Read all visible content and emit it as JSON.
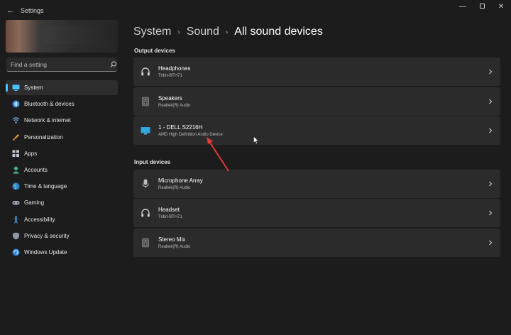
{
  "window": {
    "title": "Settings",
    "back_glyph": "←",
    "minimize_glyph": "—",
    "close_glyph": "✕"
  },
  "sidebar": {
    "search_placeholder": "Find a setting",
    "items": [
      {
        "label": "System",
        "icon": "monitor-icon",
        "selected": true
      },
      {
        "label": "Bluetooth & devices",
        "icon": "bluetooth-icon"
      },
      {
        "label": "Network & internet",
        "icon": "wifi-icon"
      },
      {
        "label": "Personalization",
        "icon": "brush-icon"
      },
      {
        "label": "Apps",
        "icon": "apps-icon"
      },
      {
        "label": "Accounts",
        "icon": "account-icon"
      },
      {
        "label": "Time & language",
        "icon": "globe-icon"
      },
      {
        "label": "Gaming",
        "icon": "gamepad-icon"
      },
      {
        "label": "Accessibility",
        "icon": "accessibility-icon"
      },
      {
        "label": "Privacy & security",
        "icon": "shield-icon"
      },
      {
        "label": "Windows Update",
        "icon": "update-icon"
      }
    ]
  },
  "breadcrumb": {
    "items": [
      "System",
      "Sound",
      "All sound devices"
    ],
    "separator": "›"
  },
  "output_devices": {
    "label": "Output devices",
    "devices": [
      {
        "name": "Headphones",
        "sub": "Tribit-BTH71",
        "icon": "headphones-icon"
      },
      {
        "name": "Speakers",
        "sub": "Realtek(R) Audio",
        "icon": "speaker-icon"
      },
      {
        "name": "1 - DELL S2216H",
        "sub": "AMD High Definition Audio Device",
        "icon": "monitor-icon"
      }
    ]
  },
  "input_devices": {
    "label": "Input devices",
    "devices": [
      {
        "name": "Microphone Array",
        "sub": "Realtek(R) Audio",
        "icon": "microphone-icon"
      },
      {
        "name": "Headset",
        "sub": "Tribit-BTH71",
        "icon": "headphones-icon"
      },
      {
        "name": "Stereo Mix",
        "sub": "Realtek(R) Audio",
        "icon": "speaker-icon"
      }
    ]
  },
  "colors": {
    "background": "#1c1c1c",
    "card": "#2b2b2b",
    "accent": "#4cc2ff",
    "annotation": "#e53935"
  }
}
